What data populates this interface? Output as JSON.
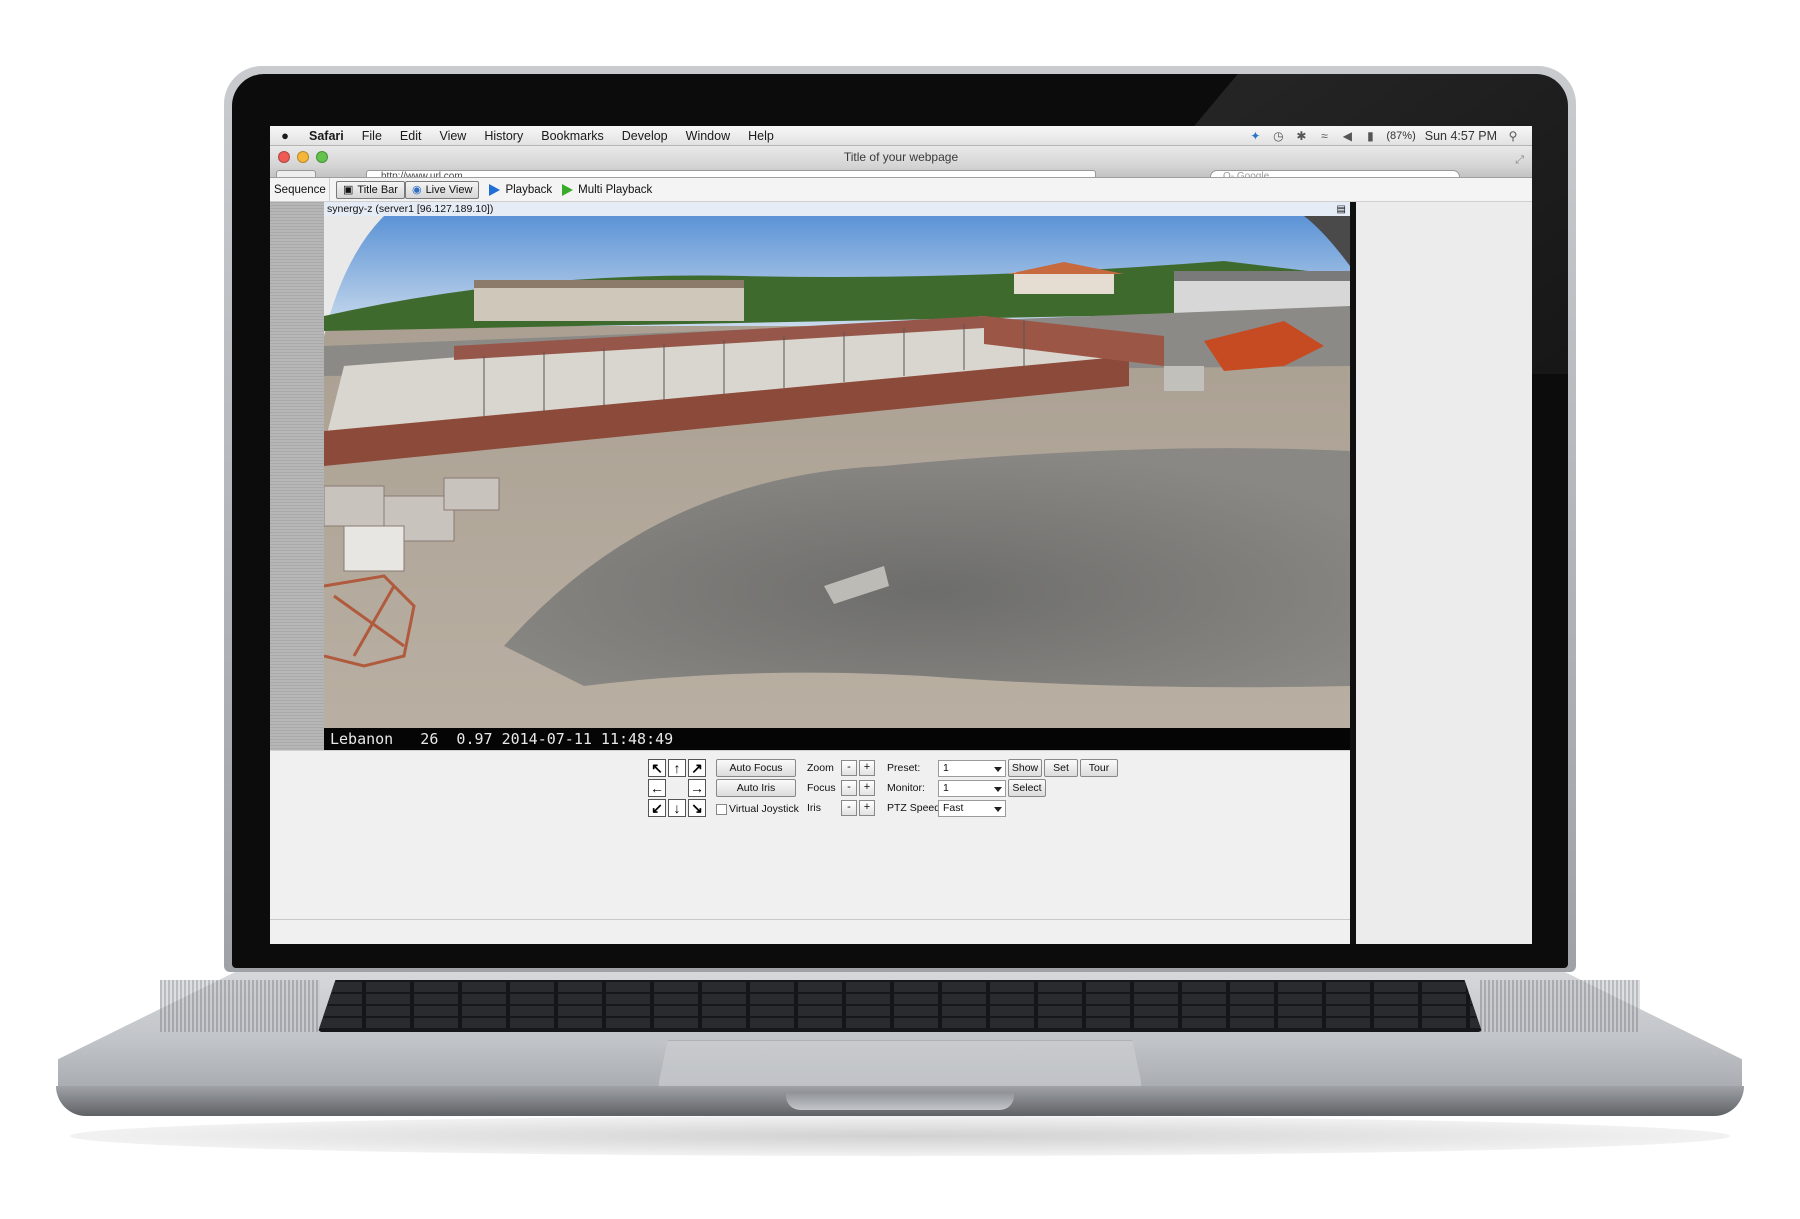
{
  "menubar": {
    "apple_icon": "apple-logo-icon",
    "items": [
      "Safari",
      "File",
      "Edit",
      "View",
      "History",
      "Bookmarks",
      "Develop",
      "Window",
      "Help"
    ],
    "battery": "(87%)",
    "clock": "Sun 4:57 PM"
  },
  "browser": {
    "window_title": "Title of your webpage",
    "address": "http://www.url.com",
    "search_placeholder": "Q- Google"
  },
  "app": {
    "sequence_label": "Sequence",
    "tabs": {
      "title_bar": "Title Bar",
      "live_view": "Live View",
      "playback": "Playback",
      "multi_playback": "Multi Playback"
    },
    "camera_header": "synergy-z (server1 [96.127.189.10])",
    "osd": "Lebanon   26  0.97 2014-07-11 11:48:49"
  },
  "ptz": {
    "auto_focus": "Auto Focus",
    "auto_iris": "Auto Iris",
    "virtual_joystick": "Virtual Joystick",
    "zoom_label": "Zoom",
    "focus_label": "Focus",
    "iris_label": "Iris",
    "minus": "-",
    "plus": "+",
    "preset_label": "Preset:",
    "preset_value": "1",
    "monitor_label": "Monitor:",
    "monitor_value": "1",
    "speed_label": "PTZ Speed:",
    "speed_value": "Fast",
    "show": "Show",
    "set": "Set",
    "tour": "Tour",
    "select": "Select"
  },
  "colors": {
    "close": "#ee5b55",
    "minimize": "#f5b63a",
    "zoom": "#63c24c",
    "playback_accent": "#1f6fd6",
    "multi_playback_accent": "#3aaa2b"
  }
}
